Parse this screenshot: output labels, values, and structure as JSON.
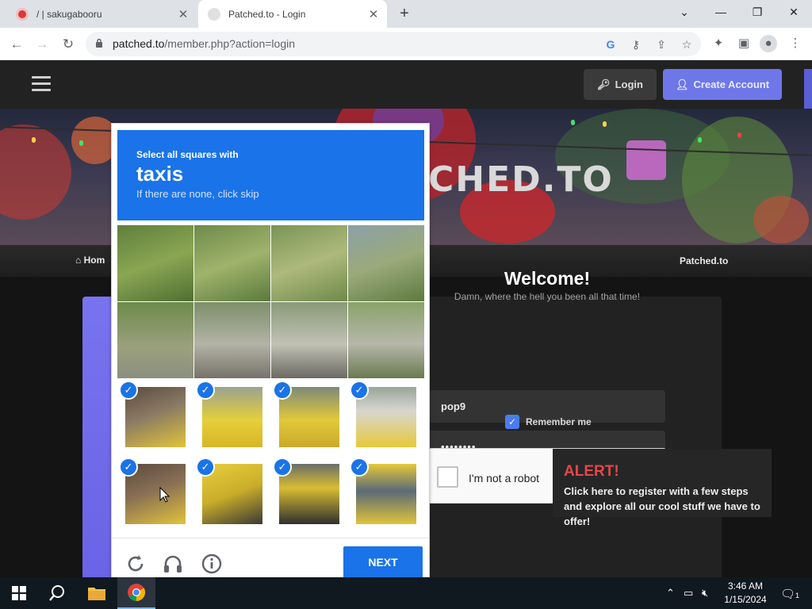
{
  "browser": {
    "tabs": [
      {
        "title": "/ | sakugabooru",
        "close": "✕"
      },
      {
        "title": "Patched.to - Login",
        "close": "✕"
      }
    ],
    "new_tab": "+",
    "url_host": "patched.to",
    "url_path": "/member.php?action=login"
  },
  "site": {
    "login_label": "Login",
    "create_account_label": "Create Account",
    "banner_logo": "CHED.TO",
    "breadcrumb_home": "Hom",
    "breadcrumb_site": "Patched.to"
  },
  "login": {
    "title": "Welcome!",
    "subtitle": "Damn, where the hell you been all that time!",
    "username": "pop9",
    "password": "••••••••",
    "remember_label": "Remember me",
    "robot_label": "I'm not a robot"
  },
  "alert": {
    "title": "ALERT!",
    "body": "Click here to register with a few steps and explore all our cool stuff we have to offer!"
  },
  "captcha": {
    "instruction": "Select all squares with",
    "target": "taxis",
    "hint": "If there are none, click skip",
    "next_label": "NEXT",
    "selected_cells": [
      8,
      9,
      10,
      11,
      12,
      13,
      14,
      15
    ]
  },
  "taskbar": {
    "time": "3:46 AM",
    "date": "1/15/2024",
    "notifications": "1"
  }
}
